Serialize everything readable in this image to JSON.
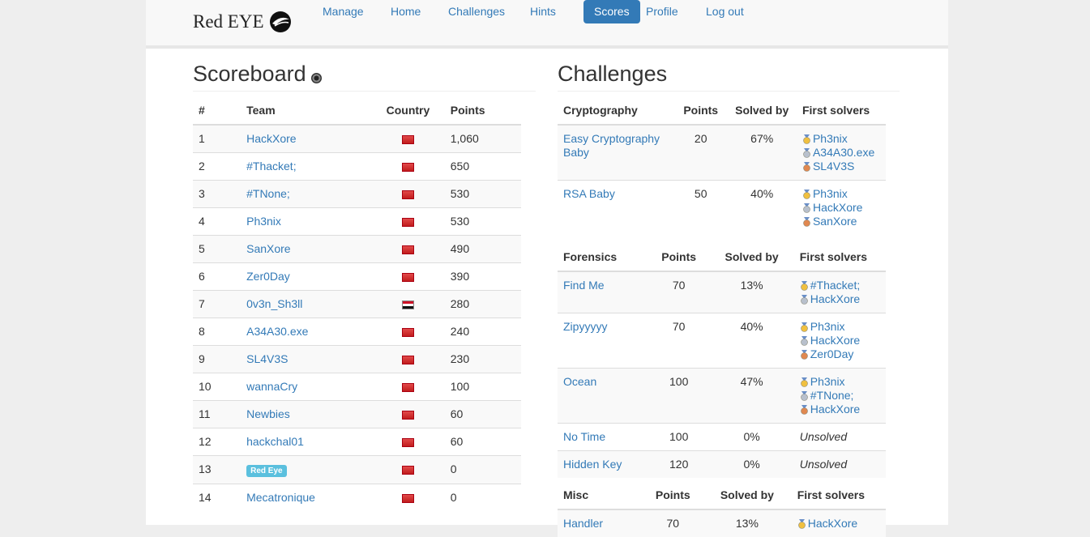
{
  "nav": {
    "brand": "Red EYE",
    "items": [
      {
        "label": "Manage"
      },
      {
        "label": "Home"
      },
      {
        "label": "Challenges"
      },
      {
        "label": "Hints"
      },
      {
        "label": "Scores"
      },
      {
        "label": "Profile"
      },
      {
        "label": "Log out"
      }
    ],
    "active": "Scores"
  },
  "scoreboard": {
    "title": "Scoreboard",
    "headers": [
      "#",
      "Team",
      "Country",
      "Points"
    ],
    "rows": [
      {
        "rank": "1",
        "team": "HackXore",
        "points": "1,060",
        "flag": "red"
      },
      {
        "rank": "2",
        "team": "#Thacket;",
        "points": "650",
        "flag": "red"
      },
      {
        "rank": "3",
        "team": "#TNone;",
        "points": "530",
        "flag": "red"
      },
      {
        "rank": "4",
        "team": "Ph3nix",
        "points": "530",
        "flag": "red"
      },
      {
        "rank": "5",
        "team": "SanXore",
        "points": "490",
        "flag": "red"
      },
      {
        "rank": "6",
        "team": "Zer0Day",
        "points": "390",
        "flag": "red"
      },
      {
        "rank": "7",
        "team": "0v3n_Sh3ll",
        "points": "280",
        "flag": "egypt"
      },
      {
        "rank": "8",
        "team": "A34A30.exe",
        "points": "240",
        "flag": "red"
      },
      {
        "rank": "9",
        "team": "SL4V3S",
        "points": "230",
        "flag": "red"
      },
      {
        "rank": "10",
        "team": "wannaCry",
        "points": "100",
        "flag": "red"
      },
      {
        "rank": "11",
        "team": "Newbies",
        "points": "60",
        "flag": "red"
      },
      {
        "rank": "12",
        "team": "hackchal01",
        "points": "60",
        "flag": "red"
      },
      {
        "rank": "13",
        "team": "Red Eye",
        "points": "0",
        "flag": "red",
        "badge": true
      },
      {
        "rank": "14",
        "team": "Mecatronique",
        "points": "0",
        "flag": "red"
      }
    ]
  },
  "challenges": {
    "title": "Challenges",
    "categories": [
      {
        "name": "Cryptography",
        "headers": [
          "Points",
          "Solved by",
          "First solvers"
        ],
        "rows": [
          {
            "name": "Easy Cryptography Baby",
            "points": "20",
            "solved": "67%",
            "solvers": [
              "Ph3nix",
              "A34A30.exe",
              "SL4V3S"
            ]
          },
          {
            "name": "RSA Baby",
            "points": "50",
            "solved": "40%",
            "solvers": [
              "Ph3nix",
              "HackXore",
              "SanXore"
            ]
          }
        ]
      },
      {
        "name": "Forensics",
        "headers": [
          "Points",
          "Solved by",
          "First solvers"
        ],
        "rows": [
          {
            "name": "Find Me",
            "points": "70",
            "solved": "13%",
            "solvers": [
              "#Thacket;",
              "HackXore"
            ]
          },
          {
            "name": "Zipyyyyy",
            "points": "70",
            "solved": "40%",
            "solvers": [
              "Ph3nix",
              "HackXore",
              "Zer0Day"
            ]
          },
          {
            "name": "Ocean",
            "points": "100",
            "solved": "47%",
            "solvers": [
              "Ph3nix",
              "#TNone;",
              "HackXore"
            ]
          },
          {
            "name": "No Time",
            "points": "100",
            "solved": "0%",
            "solvers": [],
            "unsolved": "Unsolved"
          },
          {
            "name": "Hidden Key",
            "points": "120",
            "solved": "0%",
            "solvers": [],
            "unsolved": "Unsolved"
          }
        ]
      },
      {
        "name": "Misc",
        "headers": [
          "Points",
          "Solved by",
          "First solvers"
        ],
        "rows": [
          {
            "name": "Handler",
            "points": "70",
            "solved": "13%",
            "solvers": [
              "HackXore"
            ]
          }
        ]
      }
    ]
  },
  "colors": {
    "link": "#337ab7",
    "active": "#337ab7",
    "badge": "#5bc0de",
    "gold": "#f0c040",
    "silver": "#b8c0cc",
    "bronze": "#e08850"
  }
}
